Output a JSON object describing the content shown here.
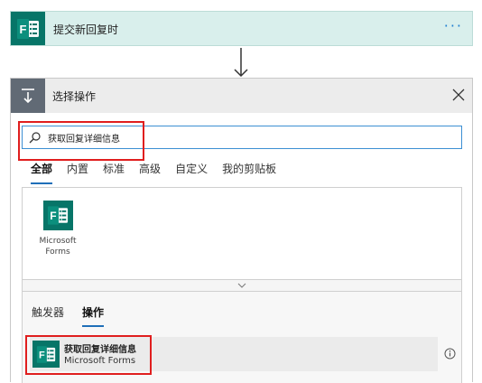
{
  "trigger": {
    "title": "提交新回复时",
    "more_label": "···",
    "icon": "microsoft-forms-icon"
  },
  "action_picker": {
    "title": "选择操作",
    "icon": "insert-step-icon",
    "close_icon": "close-icon",
    "search": {
      "value": "获取回复详细信息",
      "placeholder": "",
      "icon": "search-icon"
    },
    "tabs": [
      {
        "label": "全部",
        "active": true
      },
      {
        "label": "内置",
        "active": false
      },
      {
        "label": "标准",
        "active": false
      },
      {
        "label": "高级",
        "active": false
      },
      {
        "label": "自定义",
        "active": false
      },
      {
        "label": "我的剪贴板",
        "active": false
      }
    ],
    "connectors": [
      {
        "name": "Microsoft Forms",
        "icon": "microsoft-forms-icon"
      }
    ],
    "sub_tabs": [
      {
        "label": "触发器",
        "active": false
      },
      {
        "label": "操作",
        "active": true
      }
    ],
    "actions": [
      {
        "name": "获取回复详细信息",
        "connector": "Microsoft Forms",
        "icon": "microsoft-forms-icon"
      }
    ]
  },
  "colors": {
    "forms_green": "#077568",
    "trigger_bg": "#d9efec",
    "highlight_red": "#e01e1e",
    "accent_blue": "#1f6fb8"
  }
}
